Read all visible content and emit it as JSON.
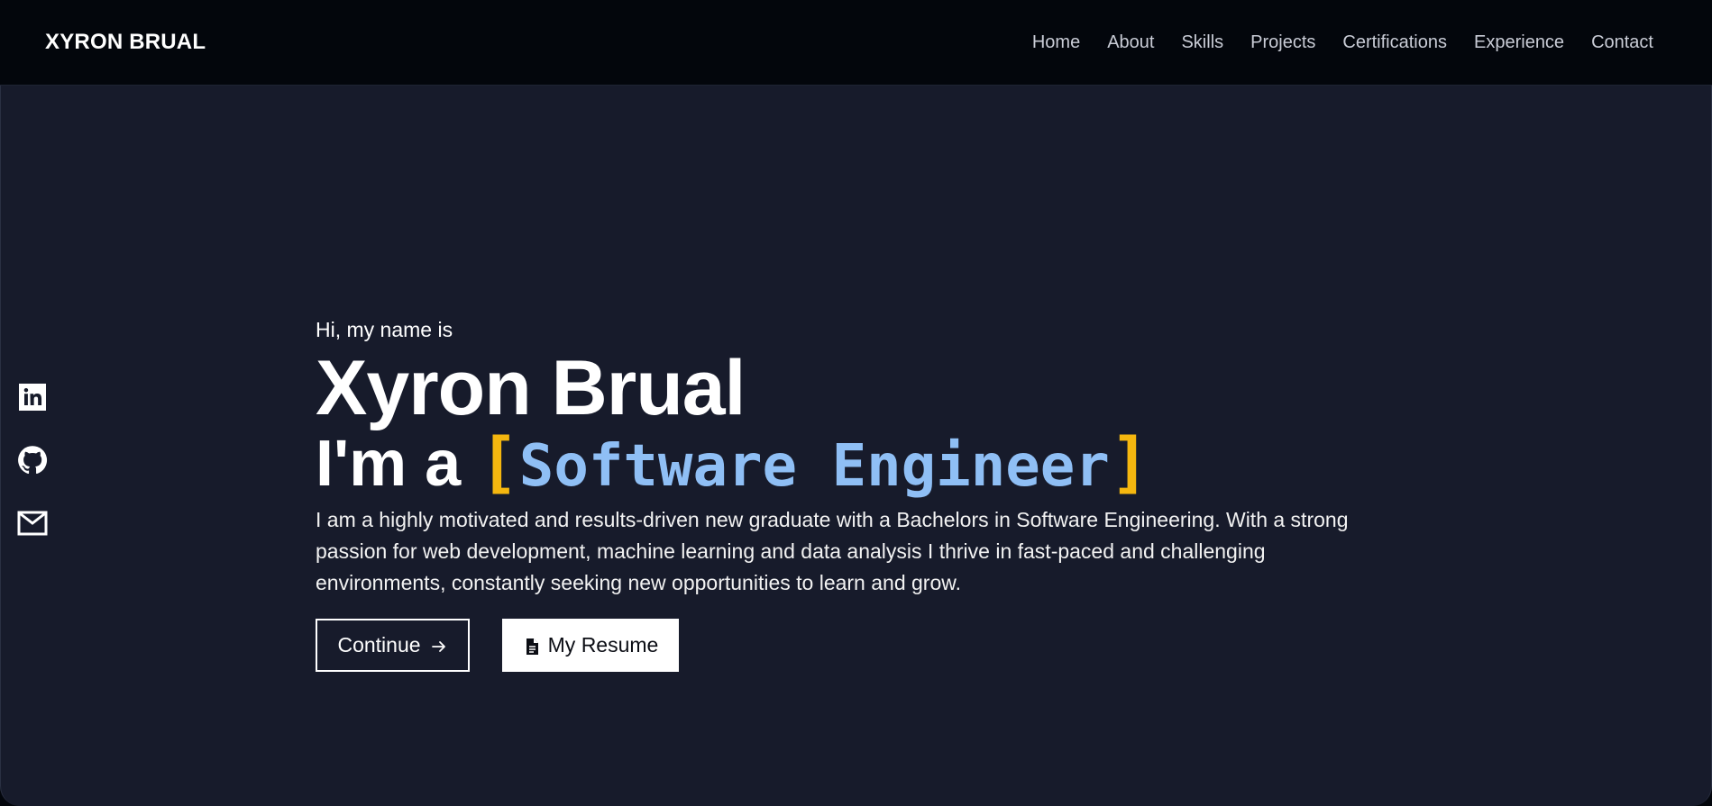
{
  "nav": {
    "brand": "XYRON BRUAL",
    "links": [
      "Home",
      "About",
      "Skills",
      "Projects",
      "Certifications",
      "Experience",
      "Contact"
    ]
  },
  "socials": [
    {
      "icon": "linkedin-icon"
    },
    {
      "icon": "github-icon"
    },
    {
      "icon": "mail-icon"
    }
  ],
  "hero": {
    "greeting": "Hi, my name is",
    "name": "Xyron Brual",
    "role_prefix": "I'm a",
    "bracket_open": "[",
    "role": "Software Engineer",
    "bracket_close": "]",
    "bio": "I am a highly motivated and results-driven new graduate with a Bachelors in Software Engineering. With a strong passion for web development, machine learning and data analysis I thrive in fast-paced and challenging environments, constantly seeking new opportunities to learn and grow.",
    "continue_label": "Continue",
    "resume_label": "My Resume"
  },
  "colors": {
    "background": "#171b2b",
    "navbar": "#03060c",
    "bracket": "#f5b70f",
    "role": "#8fbff5"
  }
}
